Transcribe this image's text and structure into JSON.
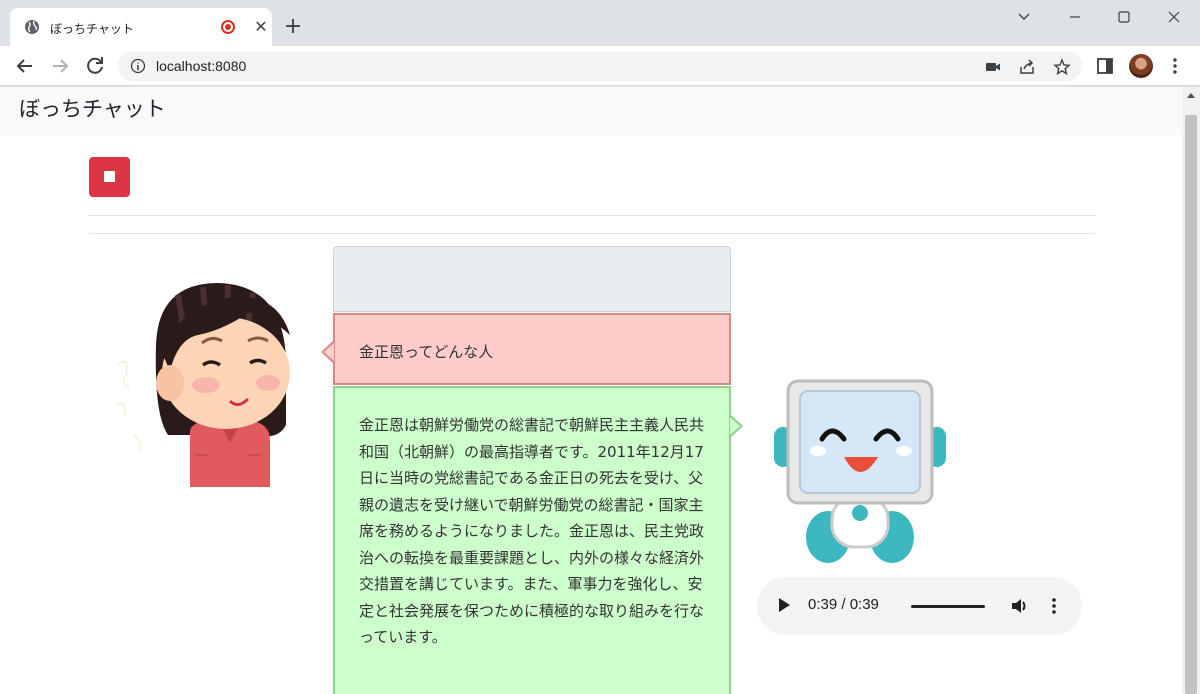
{
  "browser": {
    "tab": {
      "title": "ぼっちチャット"
    },
    "address": {
      "url": "localhost:8080"
    }
  },
  "page": {
    "brand": "ぼっちチャット",
    "stop_button": {
      "icon": "stop-icon"
    },
    "chat": {
      "user_message": "金正恩ってどんな人",
      "bot_message": "金正恩は朝鮮労働党の総書記で朝鮮民主主義人民共和国（北朝鮮）の最高指導者です。2011年12月17日に当時の党総書記である金正日の死去を受け、父親の遺志を受け継いで朝鮮労働党の総書記・国家主席を務めるようになりました。金正恩は、民主党政治への転換を最重要課題とし、内外の様々な経済外交措置を講じています。また、軍事力を強化し、安定と社会発展を保つために積極的な取り組みを行なっています。"
    },
    "audio": {
      "current": "0:39",
      "duration": "0:39",
      "time_display": "0:39 / 0:39",
      "progress": 1.0
    }
  },
  "colors": {
    "stop_button": "#dc3545",
    "user_bubble": "#ffcccc",
    "bot_bubble": "#ccffcc",
    "navbar": "#f8f9fa"
  }
}
